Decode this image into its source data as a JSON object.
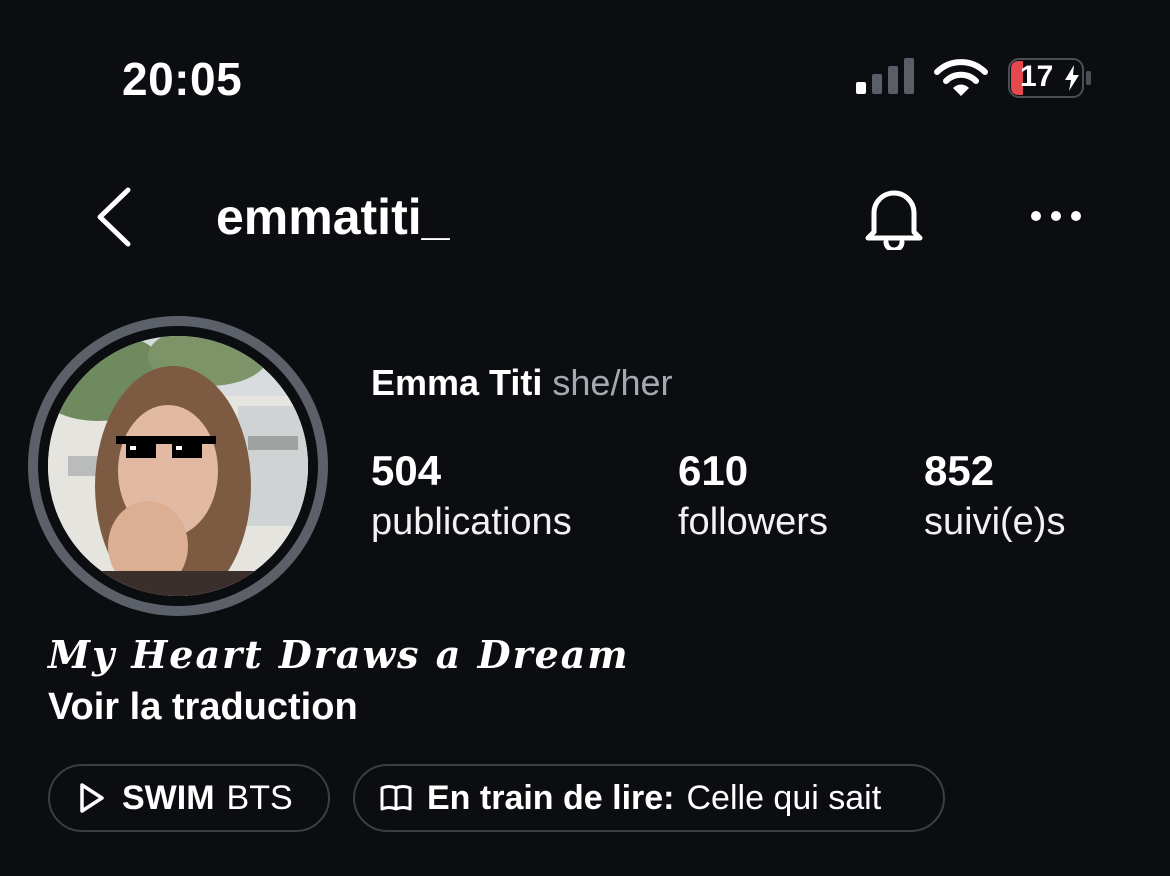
{
  "status_bar": {
    "time": "20:05",
    "battery_level": "17",
    "battery_charging": true,
    "signal_bars_active": 1,
    "signal_bars_total": 4
  },
  "header": {
    "username": "emmatiti_",
    "icons": [
      "chevron-left-icon",
      "bell-icon",
      "more-horizontal-icon"
    ]
  },
  "profile": {
    "full_name": "Emma Titi",
    "pronouns": "she/her",
    "stats": [
      {
        "value": "504",
        "label": "publications"
      },
      {
        "value": "610",
        "label": "followers"
      },
      {
        "value": "852",
        "label": "suivi(e)s"
      }
    ],
    "bio": "My Heart Draws a Dream",
    "translate_link": "Voir la traduction"
  },
  "chips": {
    "swim": {
      "icon": "play-icon",
      "bold": "SWIM",
      "rest": "BTS"
    },
    "reading": {
      "icon": "book-icon",
      "bold": "En train de lire:",
      "rest": "Celle qui sait"
    }
  },
  "colors": {
    "background": "#0b0d11",
    "muted_text": "#a4a8b0",
    "battery_low": "#e5484d",
    "chip_border": "#3a3e45"
  }
}
